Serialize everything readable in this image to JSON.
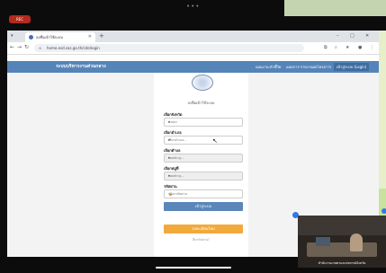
{
  "recording": {
    "label": "REC"
  },
  "browser": {
    "tab_title": "ลงชื่อเข้าใช้ระบบ",
    "url": "home.esd.sas.go.th/site/login",
    "window_controls": [
      "–",
      "□",
      "✕"
    ]
  },
  "site": {
    "brand": "ระบบบริหารงานส่วนกลาง",
    "nav": [
      "แผนงาน-ตัวชี้วัด",
      "แผนการ-รายงานผลโครงการ",
      "เข้าสู่ระบบ (Login)"
    ]
  },
  "login": {
    "title": "ลงชื่อเข้าใช้ระบบ",
    "fields": [
      {
        "label": "เลือกจังหวัด",
        "value": "สงขลา",
        "caret": "▾"
      },
      {
        "label": "เลือกอำเภอ",
        "value": "เลือกอำเภอ...",
        "caret": "▾"
      },
      {
        "label": "เลือกตำบล",
        "value": "Loading...",
        "caret": "▾"
      },
      {
        "label": "เลือกหมู่ที่",
        "value": "Loading...",
        "caret": "▾"
      },
      {
        "label": "รหัสผ่าน",
        "value": "กรอกรหัสผ่าน",
        "caret": "🔒"
      }
    ],
    "login_button": "เข้าสู่ระบบ",
    "register_button": "ลงทะเบียนใหม่",
    "forgot": "ลืมรหัสผ่าน?"
  },
  "video": {
    "caption": "สำนักงานเกษตรและสหกรณ์จังหวัด"
  },
  "colors": {
    "nav": "#5584b8",
    "login": "#5a86ba",
    "register": "#f2a93b"
  }
}
